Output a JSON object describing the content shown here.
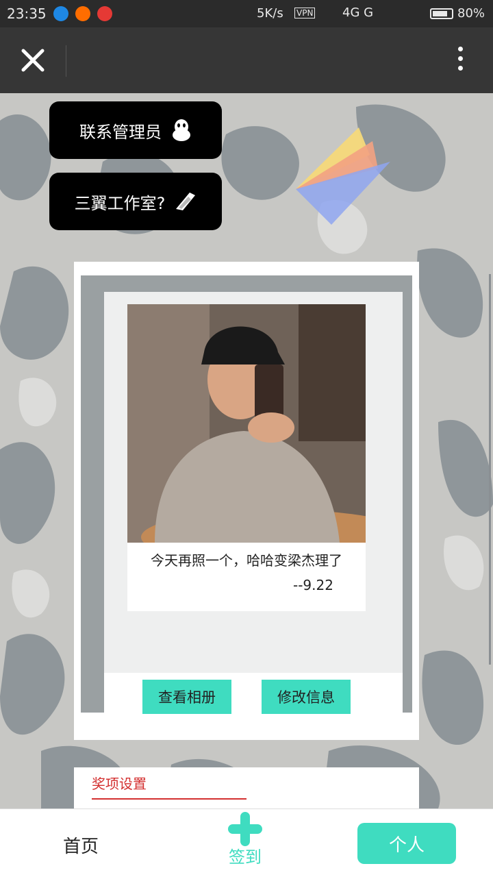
{
  "status_bar": {
    "time": "23:35",
    "network_speed": "5K/s",
    "vpn_label": "VPN",
    "signal_text": "4G  G",
    "battery_percent_text": "80%",
    "battery_level": 0.8
  },
  "title_bar": {
    "close_icon": "close-icon",
    "more_icon": "more-vertical-icon"
  },
  "contact_admin": {
    "label": "联系管理员",
    "icon": "qq-penguin-icon"
  },
  "studio": {
    "label": "三翼工作室?",
    "icon": "wing-icon"
  },
  "profile": {
    "caption_line1": "今天再照一个，哈哈变梁杰理了",
    "caption_line2": "--9.22"
  },
  "buttons": {
    "view_album": "查看相册",
    "edit_info": "修改信息"
  },
  "awards": {
    "title": "奖项设置"
  },
  "bottom_nav": {
    "home": "首页",
    "checkin": "签到",
    "me": "个人"
  },
  "colors": {
    "accent": "#3fdcc0",
    "awards_red": "#d32f2f",
    "title_bar": "#363636"
  }
}
